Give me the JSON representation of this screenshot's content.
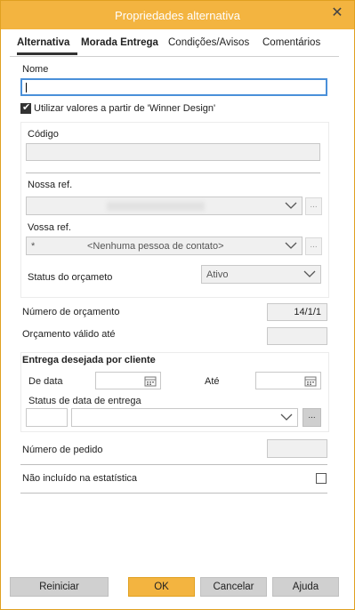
{
  "window": {
    "title": "Propriedades alternativa"
  },
  "tabs": [
    {
      "label": "Alternativa",
      "active": true
    },
    {
      "label": "Morada Entrega",
      "active": false
    },
    {
      "label": "Condições/Avisos",
      "active": false
    },
    {
      "label": "Comentários",
      "active": false
    }
  ],
  "form": {
    "nome_label": "Nome",
    "nome_value": "",
    "use_values_checked": true,
    "use_values_label": "Utilizar valores a partir de 'Winner Design'",
    "codigo_label": "Código",
    "codigo_value": "",
    "nossa_ref_label": "Nossa ref.",
    "vossa_ref_label": "Vossa ref.",
    "vossa_ref_prefix": "*",
    "vossa_ref_value": "<Nenhuma pessoa de contato>",
    "status_orcamento_label": "Status do orçameto",
    "status_orcamento_value": "Ativo",
    "numero_orcamento_label": "Número de orçamento",
    "numero_orcamento_value": "14/1/1",
    "orcamento_valido_label": "Orçamento válido até",
    "orcamento_valido_value": "",
    "entrega_title": "Entrega desejada por cliente",
    "de_data_label": "De data",
    "ate_label": "Até",
    "status_entrega_label": "Status de data de entrega",
    "dots_label": "...",
    "numero_pedido_label": "Número de pedido",
    "numero_pedido_value": "",
    "nao_incluido_label": "Não incluído na estatística",
    "nao_incluido_checked": false
  },
  "buttons": {
    "reiniciar": "Reiniciar",
    "ok": "OK",
    "cancelar": "Cancelar",
    "ajuda": "Ajuda"
  },
  "colors": {
    "accent": "#f3b440",
    "focus_border": "#4a90d9"
  },
  "icons": {
    "close": "close-icon",
    "chevron": "chevron-down-icon",
    "calendar": "calendar-icon",
    "check": "checkmark-icon"
  }
}
